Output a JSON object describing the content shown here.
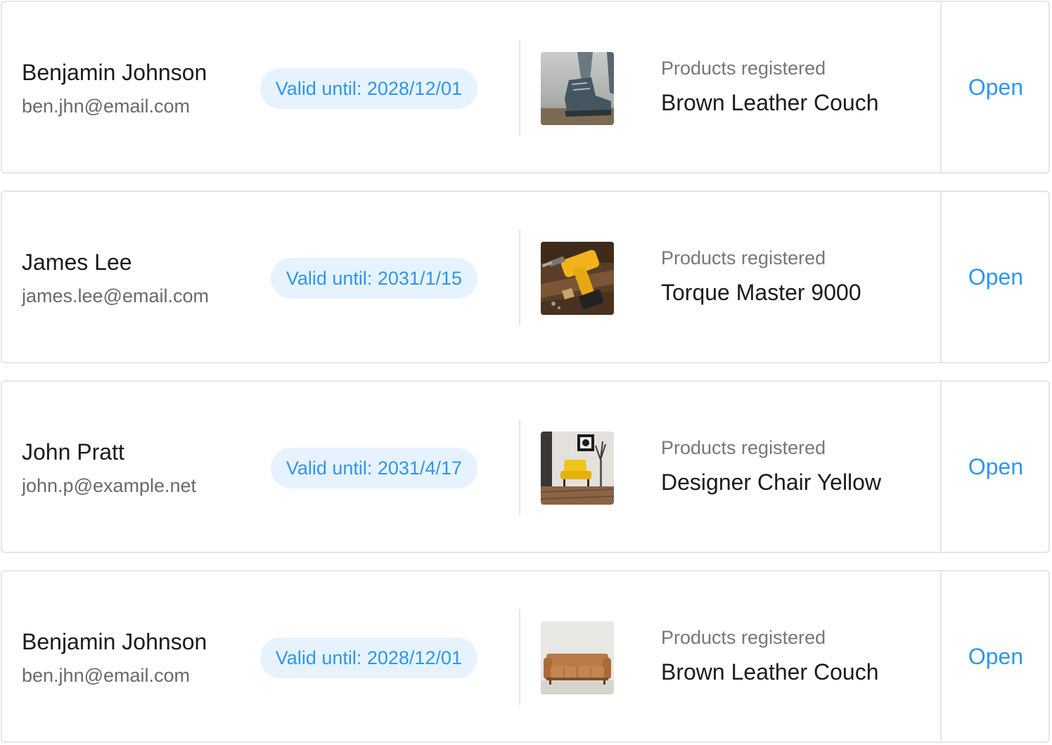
{
  "registrations": [
    {
      "name": "Benjamin Johnson",
      "email": "ben.jhn@email.com",
      "validity": "Valid until: 2028/12/01",
      "product_label": "Products registered",
      "product_name": "Brown Leather Couch",
      "thumbnail_icon": "hiking-boot-photo",
      "action_label": "Open"
    },
    {
      "name": "James Lee",
      "email": "james.lee@email.com",
      "validity": "Valid until: 2031/1/15",
      "product_label": "Products registered",
      "product_name": "Torque Master 9000",
      "thumbnail_icon": "power-drill-photo",
      "action_label": "Open"
    },
    {
      "name": "John Pratt",
      "email": "john.p@example.net",
      "validity": "Valid until: 2031/4/17",
      "product_label": "Products registered",
      "product_name": "Designer Chair Yellow",
      "thumbnail_icon": "yellow-armchair-photo",
      "action_label": "Open"
    },
    {
      "name": "Benjamin Johnson",
      "email": "ben.jhn@email.com",
      "validity": "Valid until: 2028/12/01",
      "product_label": "Products registered",
      "product_name": "Brown Leather Couch",
      "thumbnail_icon": "leather-couch-photo",
      "action_label": "Open"
    }
  ],
  "colors": {
    "accent": "#2f96ee",
    "badge_bg": "#e6f3fe",
    "border": "#e3e5e8",
    "text_primary": "#1b1b1b",
    "text_secondary": "#666a70"
  }
}
